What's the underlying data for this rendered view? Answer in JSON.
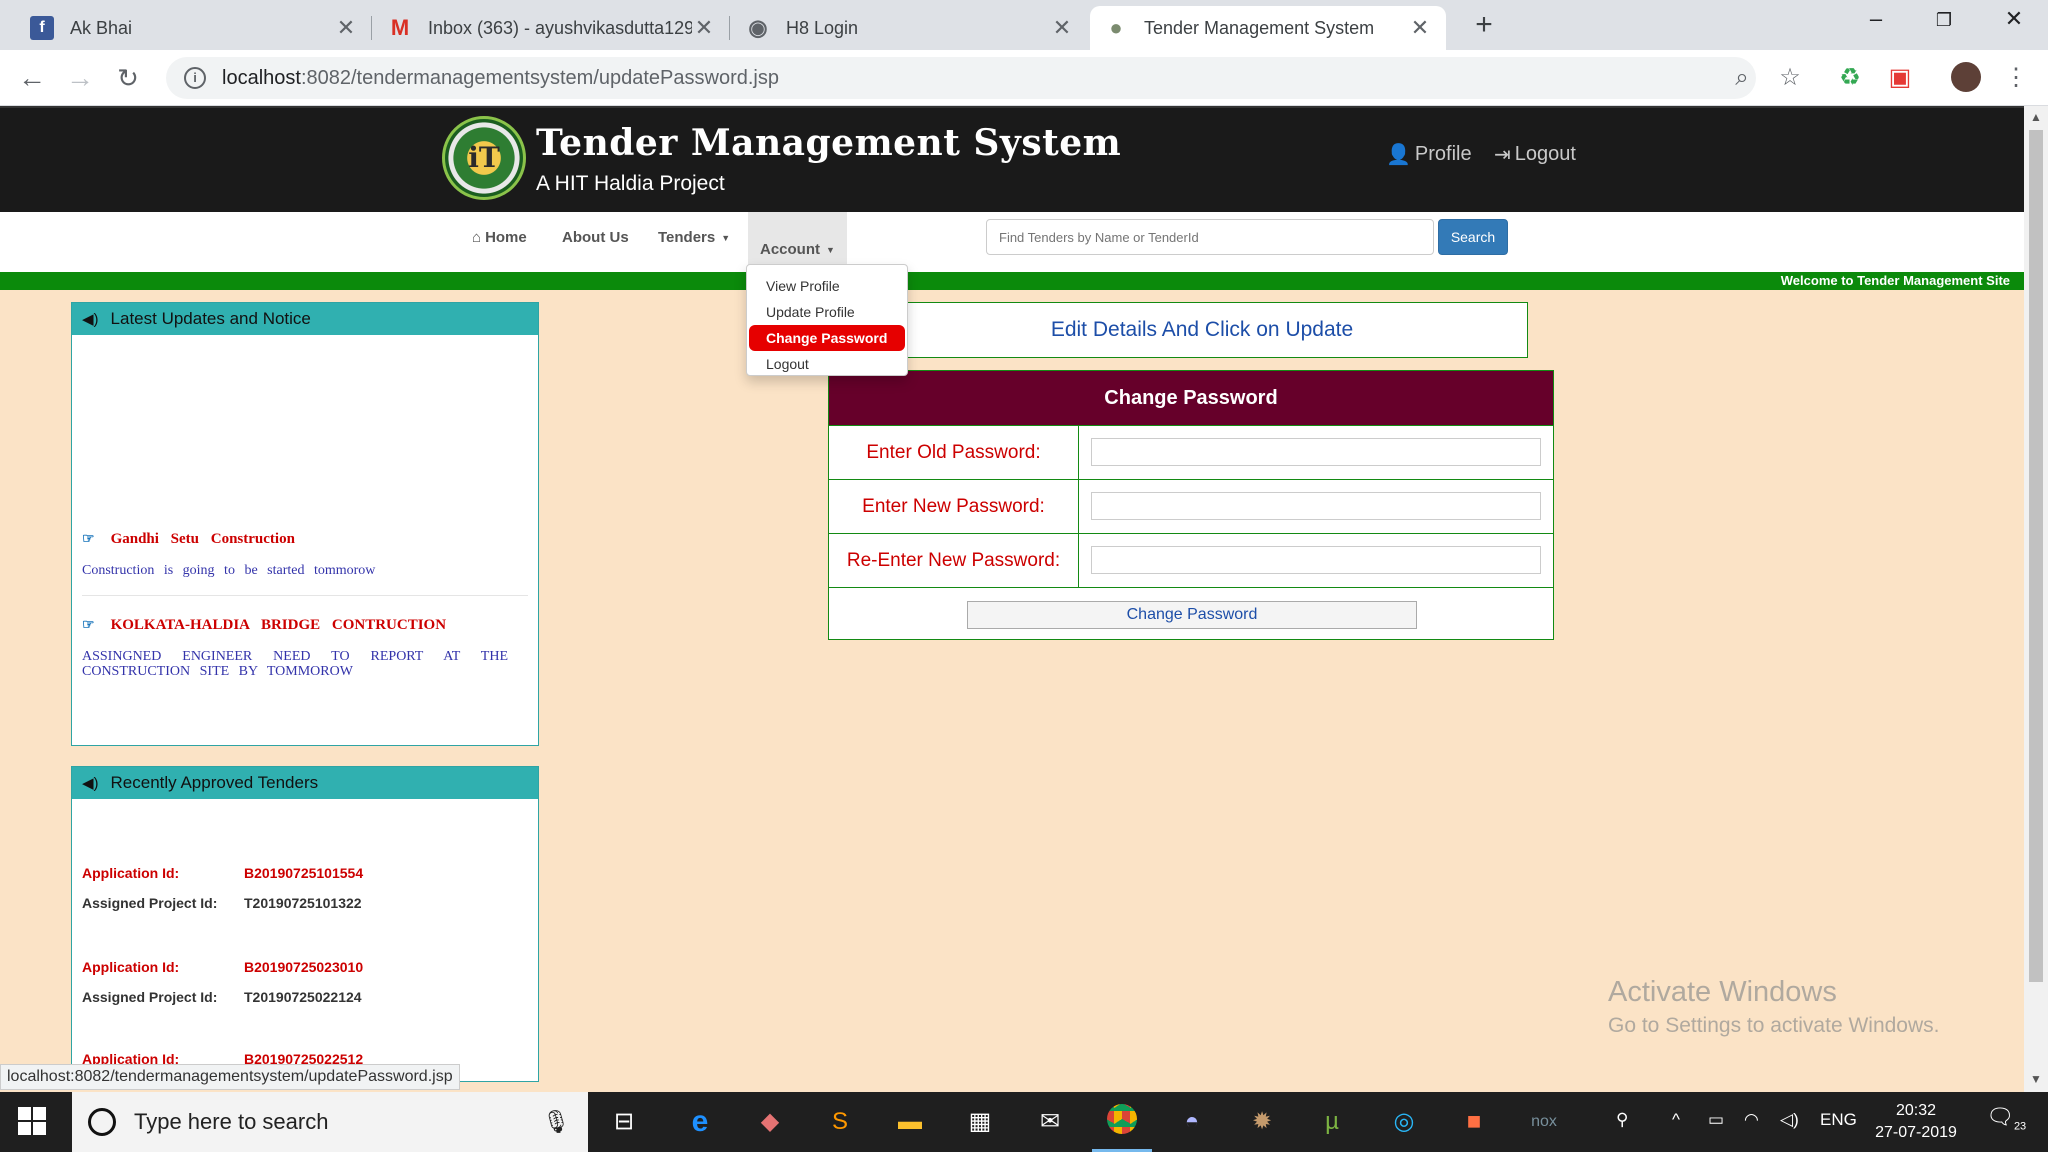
{
  "browser": {
    "tabs": [
      {
        "title": "Ak Bhai",
        "icon": "facebook-icon",
        "favicon": "f",
        "color": "#3b5998",
        "active": false
      },
      {
        "title": "Inbox (363) - ayushvikasdutta129",
        "icon": "gmail-icon",
        "favicon": "M",
        "color": "#d93025",
        "active": false
      },
      {
        "title": "H8 Login",
        "icon": "globe-icon",
        "favicon": "◉",
        "color": "#5f6368",
        "active": false
      },
      {
        "title": "Tender Management System",
        "icon": "site-icon",
        "favicon": "●",
        "color": "#7b8b6f",
        "active": true
      }
    ],
    "url_host": "localhost",
    "url_path": ":8082/tendermanagementsystem/updatePassword.jsp"
  },
  "header": {
    "title": "Tender Management System",
    "subtitle": "A HIT Haldia Project",
    "profile_label": "Profile",
    "logout_label": "Logout"
  },
  "nav": {
    "home": "Home",
    "about": "About Us",
    "tenders": "Tenders",
    "account": "Account",
    "search_placeholder": "Find Tenders by Name or TenderId",
    "search_button": "Search"
  },
  "marquee": "Welcome to Tender Management Site",
  "account_menu": {
    "items": [
      "View Profile",
      "Update Profile",
      "Change Password",
      "Logout"
    ],
    "active_index": 2
  },
  "notices": {
    "heading": "Latest Updates and Notice",
    "items": [
      {
        "title": "Gandhi Setu Construction",
        "body": "Construction is going to be started tommorow"
      },
      {
        "title": "KOLKATA-HALDIA BRIDGE CONTRUCTION",
        "body": "ASSINGNED ENGINEER NEED TO REPORT AT THE CONSTRUCTION SITE BY TOMMOROW"
      }
    ]
  },
  "approved": {
    "heading": "Recently Approved Tenders",
    "app_label": "Application Id:",
    "proj_label": "Assigned Project Id:",
    "items": [
      {
        "app_id": "B20190725101554",
        "proj_id": "T20190725101322"
      },
      {
        "app_id": "B20190725023010",
        "proj_id": "T20190725022124"
      },
      {
        "app_id": "B20190725022512",
        "proj_id": ""
      }
    ]
  },
  "form": {
    "instruction": "Edit Details And Click on Update",
    "heading": "Change Password",
    "old_label": "Enter Old Password:",
    "new_label": "Enter New Password:",
    "re_label": "Re-Enter New Password:",
    "submit": "Change Password"
  },
  "watermark": {
    "line1": "Activate Windows",
    "line2": "Go to Settings to activate Windows."
  },
  "status_url": "localhost:8082/tendermanagementsystem/updatePassword.jsp",
  "taskbar": {
    "search_placeholder": "Type here to search",
    "lang": "ENG",
    "time": "20:32",
    "date": "27-07-2019",
    "notif_count": "23"
  }
}
